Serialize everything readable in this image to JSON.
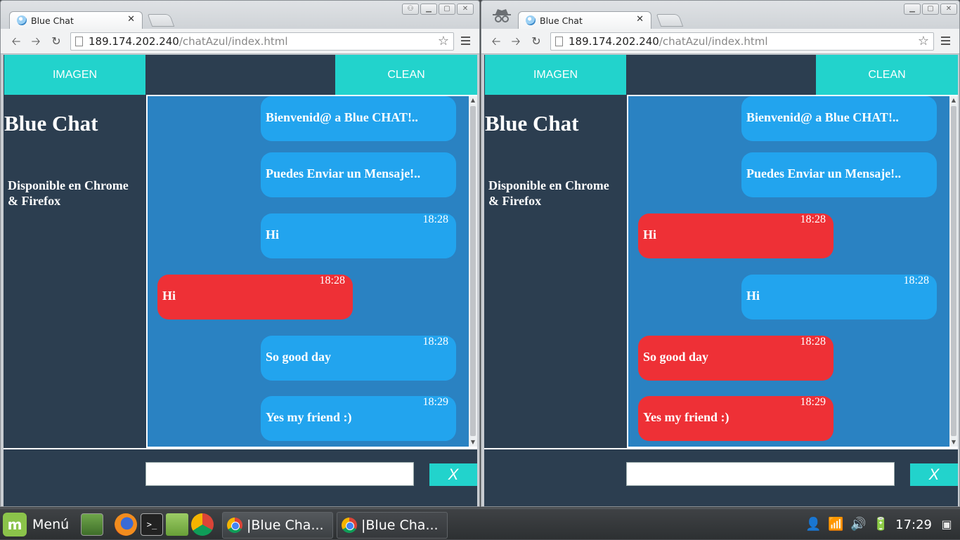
{
  "browser_left": {
    "tab_title": "Blue Chat",
    "url_host": "189.174.202.240",
    "url_path": "/chatAzul/index.html"
  },
  "browser_right": {
    "tab_title": "Blue Chat",
    "url_host": "189.174.202.240",
    "url_path": "/chatAzul/index.html",
    "incognito": true
  },
  "app": {
    "imagen_label": "IMAGEN",
    "clean_label": "CLEAN",
    "title": "Blue Chat",
    "subtitle": "Disponible en Chrome & Firefox",
    "send_label": "X",
    "input_value": "",
    "input_placeholder": ""
  },
  "chat_left": {
    "messages": [
      {
        "text": "Bienvenid@ a Blue CHAT!..",
        "time": "",
        "side": "own"
      },
      {
        "text": "Puedes Enviar un Mensaje!..",
        "time": "",
        "side": "own"
      },
      {
        "text": "Hi",
        "time": "18:28",
        "side": "own"
      },
      {
        "text": "Hi",
        "time": "18:28",
        "side": "other"
      },
      {
        "text": "So good day",
        "time": "18:28",
        "side": "own"
      },
      {
        "text": "Yes my friend :)",
        "time": "18:29",
        "side": "own"
      }
    ]
  },
  "chat_right": {
    "messages": [
      {
        "text": "Bienvenid@ a Blue CHAT!..",
        "time": "",
        "side": "own"
      },
      {
        "text": "Puedes Enviar un Mensaje!..",
        "time": "",
        "side": "own"
      },
      {
        "text": "Hi",
        "time": "18:28",
        "side": "other"
      },
      {
        "text": "Hi",
        "time": "18:28",
        "side": "own"
      },
      {
        "text": "So good day",
        "time": "18:28",
        "side": "other"
      },
      {
        "text": "Yes my friend :)",
        "time": "18:29",
        "side": "other"
      }
    ]
  },
  "taskbar": {
    "menu_label": "Menú",
    "tasks": [
      "|Blue Cha...",
      "|Blue Cha..."
    ],
    "clock": "17:29"
  },
  "colors": {
    "accent": "#22d3cc",
    "page_bg": "#2c3e50",
    "chat_bg": "#2a82c2",
    "own_bubble": "#22a4ee",
    "other_bubble": "#ee3036"
  },
  "icons": {
    "tab_favicon": "chat-bubble-icon",
    "back": "back-arrow-icon",
    "forward": "forward-arrow-icon",
    "reload": "reload-icon",
    "bookmark": "star-icon",
    "menu": "hamburger-menu-icon"
  }
}
